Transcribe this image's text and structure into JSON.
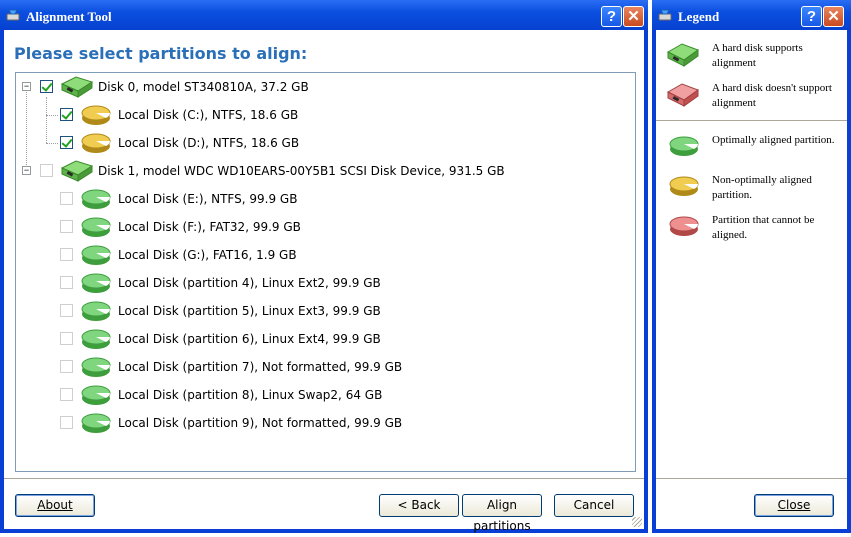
{
  "main_window": {
    "title": "Alignment Tool",
    "heading": "Please select partitions to align:",
    "help_label": "?",
    "close_label": "✕",
    "tree": [
      {
        "level": 0,
        "label": "Disk 0, model ST340810A, 37.2 GB",
        "checked": true,
        "disabled": false,
        "icon": "hard-disk-icon",
        "expanded": true
      },
      {
        "level": 1,
        "label": "Local Disk (C:), NTFS, 18.6 GB",
        "checked": true,
        "disabled": false,
        "icon": "partition-yellow-icon"
      },
      {
        "level": 1,
        "label": "Local Disk (D:), NTFS, 18.6 GB",
        "checked": true,
        "disabled": false,
        "icon": "partition-yellow-icon"
      },
      {
        "level": 0,
        "label": "Disk 1, model WDC WD10EARS-00Y5B1 SCSI Disk Device, 931.5 GB",
        "checked": false,
        "disabled": true,
        "icon": "hard-disk-icon",
        "expanded": true
      },
      {
        "level": 1,
        "label": "Local Disk (E:), NTFS, 99.9 GB",
        "checked": false,
        "disabled": true,
        "icon": "partition-green-icon"
      },
      {
        "level": 1,
        "label": "Local Disk (F:), FAT32, 99.9 GB",
        "checked": false,
        "disabled": true,
        "icon": "partition-green-icon"
      },
      {
        "level": 1,
        "label": "Local Disk (G:), FAT16, 1.9 GB",
        "checked": false,
        "disabled": true,
        "icon": "partition-green-icon"
      },
      {
        "level": 1,
        "label": "Local Disk (partition 4), Linux Ext2, 99.9 GB",
        "checked": false,
        "disabled": true,
        "icon": "partition-green-icon"
      },
      {
        "level": 1,
        "label": "Local Disk (partition 5), Linux Ext3, 99.9 GB",
        "checked": false,
        "disabled": true,
        "icon": "partition-green-icon"
      },
      {
        "level": 1,
        "label": "Local Disk (partition 6), Linux Ext4, 99.9 GB",
        "checked": false,
        "disabled": true,
        "icon": "partition-green-icon"
      },
      {
        "level": 1,
        "label": "Local Disk (partition 7), Not formatted, 99.9 GB",
        "checked": false,
        "disabled": true,
        "icon": "partition-green-icon"
      },
      {
        "level": 1,
        "label": "Local Disk (partition 8), Linux Swap2, 64 GB",
        "checked": false,
        "disabled": true,
        "icon": "partition-green-icon"
      },
      {
        "level": 1,
        "label": "Local Disk (partition 9), Not formatted, 99.9 GB",
        "checked": false,
        "disabled": true,
        "icon": "partition-green-icon"
      }
    ],
    "buttons": {
      "about": "About",
      "back": "< Back",
      "align": "Align partitions",
      "cancel": "Cancel"
    }
  },
  "legend_window": {
    "title": "Legend",
    "help_label": "?",
    "close_label": "✕",
    "items": [
      {
        "icon": "hard-disk-green-icon",
        "text": "A hard disk supports alignment"
      },
      {
        "icon": "hard-disk-red-icon",
        "text": "A hard disk doesn't support alignment"
      },
      {
        "icon": "partition-green-icon",
        "text": "Optimally aligned partition."
      },
      {
        "icon": "partition-yellow-icon",
        "text": "Non-optimally aligned partition."
      },
      {
        "icon": "partition-red-icon",
        "text": "Partition that cannot be aligned."
      }
    ],
    "close_button": "Close"
  },
  "colors": {
    "title_blue": "#0641d0",
    "heading_blue": "#2a6fb8",
    "partition_green": "#5cc25c",
    "partition_yellow": "#e0b530",
    "partition_red": "#e06060"
  }
}
